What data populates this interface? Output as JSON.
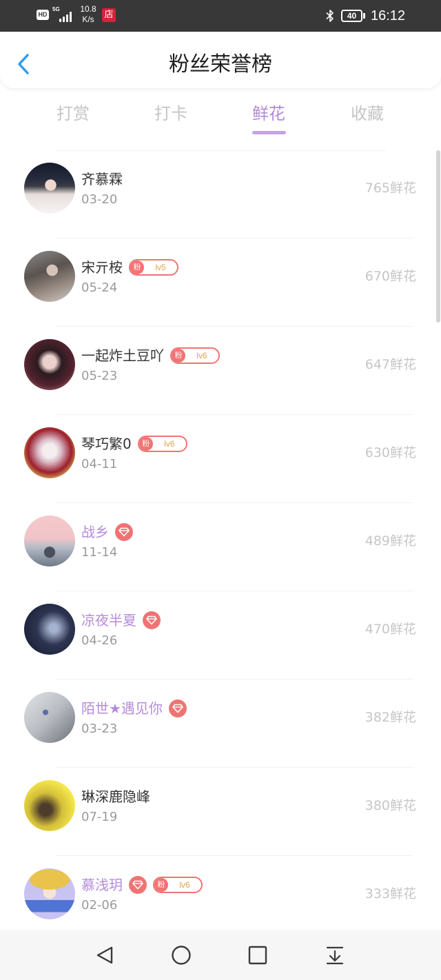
{
  "status_bar": {
    "hd": "HD",
    "network": "5G",
    "speed_value": "10.8",
    "speed_unit": "K/s",
    "store_badge": "店",
    "battery": "40",
    "time": "16:12",
    "icons": [
      "hd-icon",
      "signal-icon",
      "store-icon",
      "bluetooth-icon",
      "battery-icon"
    ]
  },
  "header": {
    "title": "粉丝荣誉榜",
    "back_icon": "chevron-left-icon"
  },
  "tabs": [
    {
      "label": "打赏",
      "selected": false
    },
    {
      "label": "打卡",
      "selected": false
    },
    {
      "label": "鲜花",
      "selected": true
    },
    {
      "label": "收藏",
      "selected": false
    }
  ],
  "list": {
    "rows": [
      {
        "name": "齐慕霖",
        "date": "03-20",
        "value": "765鲜花",
        "name_color": "#333333",
        "badges": []
      },
      {
        "name": "宋亓桉",
        "date": "05-24",
        "value": "670鲜花",
        "name_color": "#333333",
        "badges": [
          {
            "fan_label": "粉",
            "level": "lv5"
          }
        ]
      },
      {
        "name": "一起炸土豆吖",
        "date": "05-23",
        "value": "647鲜花",
        "name_color": "#333333",
        "badges": [
          {
            "fan_label": "粉",
            "level": "lv6"
          }
        ]
      },
      {
        "name": "琴巧繁0",
        "date": "04-11",
        "value": "630鲜花",
        "name_color": "#333333",
        "badges": [
          {
            "fan_label": "粉",
            "level": "lv6"
          }
        ]
      },
      {
        "name": "战乡",
        "date": "11-14",
        "value": "489鲜花",
        "name_color": "#b58bd9",
        "badges": [
          {
            "icon": "diamond-icon"
          }
        ]
      },
      {
        "name": "凉夜半夏",
        "date": "04-26",
        "value": "470鲜花",
        "name_color": "#b58bd9",
        "badges": [
          {
            "icon": "diamond-icon"
          }
        ]
      },
      {
        "name": "陌世★遇见你",
        "date": "03-23",
        "value": "382鲜花",
        "name_color": "#b58bd9",
        "badges": [
          {
            "icon": "diamond-icon"
          }
        ]
      },
      {
        "name": "琳深鹿隐峰",
        "date": "07-19",
        "value": "380鲜花",
        "name_color": "#333333",
        "badges": []
      },
      {
        "name": "慕浅玥",
        "date": "02-06",
        "value": "333鲜花",
        "name_color": "#b58bd9",
        "badges": [
          {
            "icon": "diamond-icon"
          },
          {
            "fan_label": "粉",
            "level": "lv6"
          }
        ]
      }
    ]
  },
  "nav_bar": {
    "icons": [
      "back-triangle-icon",
      "home-circle-icon",
      "recents-square-icon",
      "notification-pulldown-icon"
    ]
  },
  "theme": {
    "accent": "#b48ad8",
    "back_arrow": "#2f9bea",
    "badge_red": "#f07373",
    "badge_level": "#e3a24c",
    "value_gray": "#c6c6c6",
    "status_bar_bg": "#383838"
  }
}
